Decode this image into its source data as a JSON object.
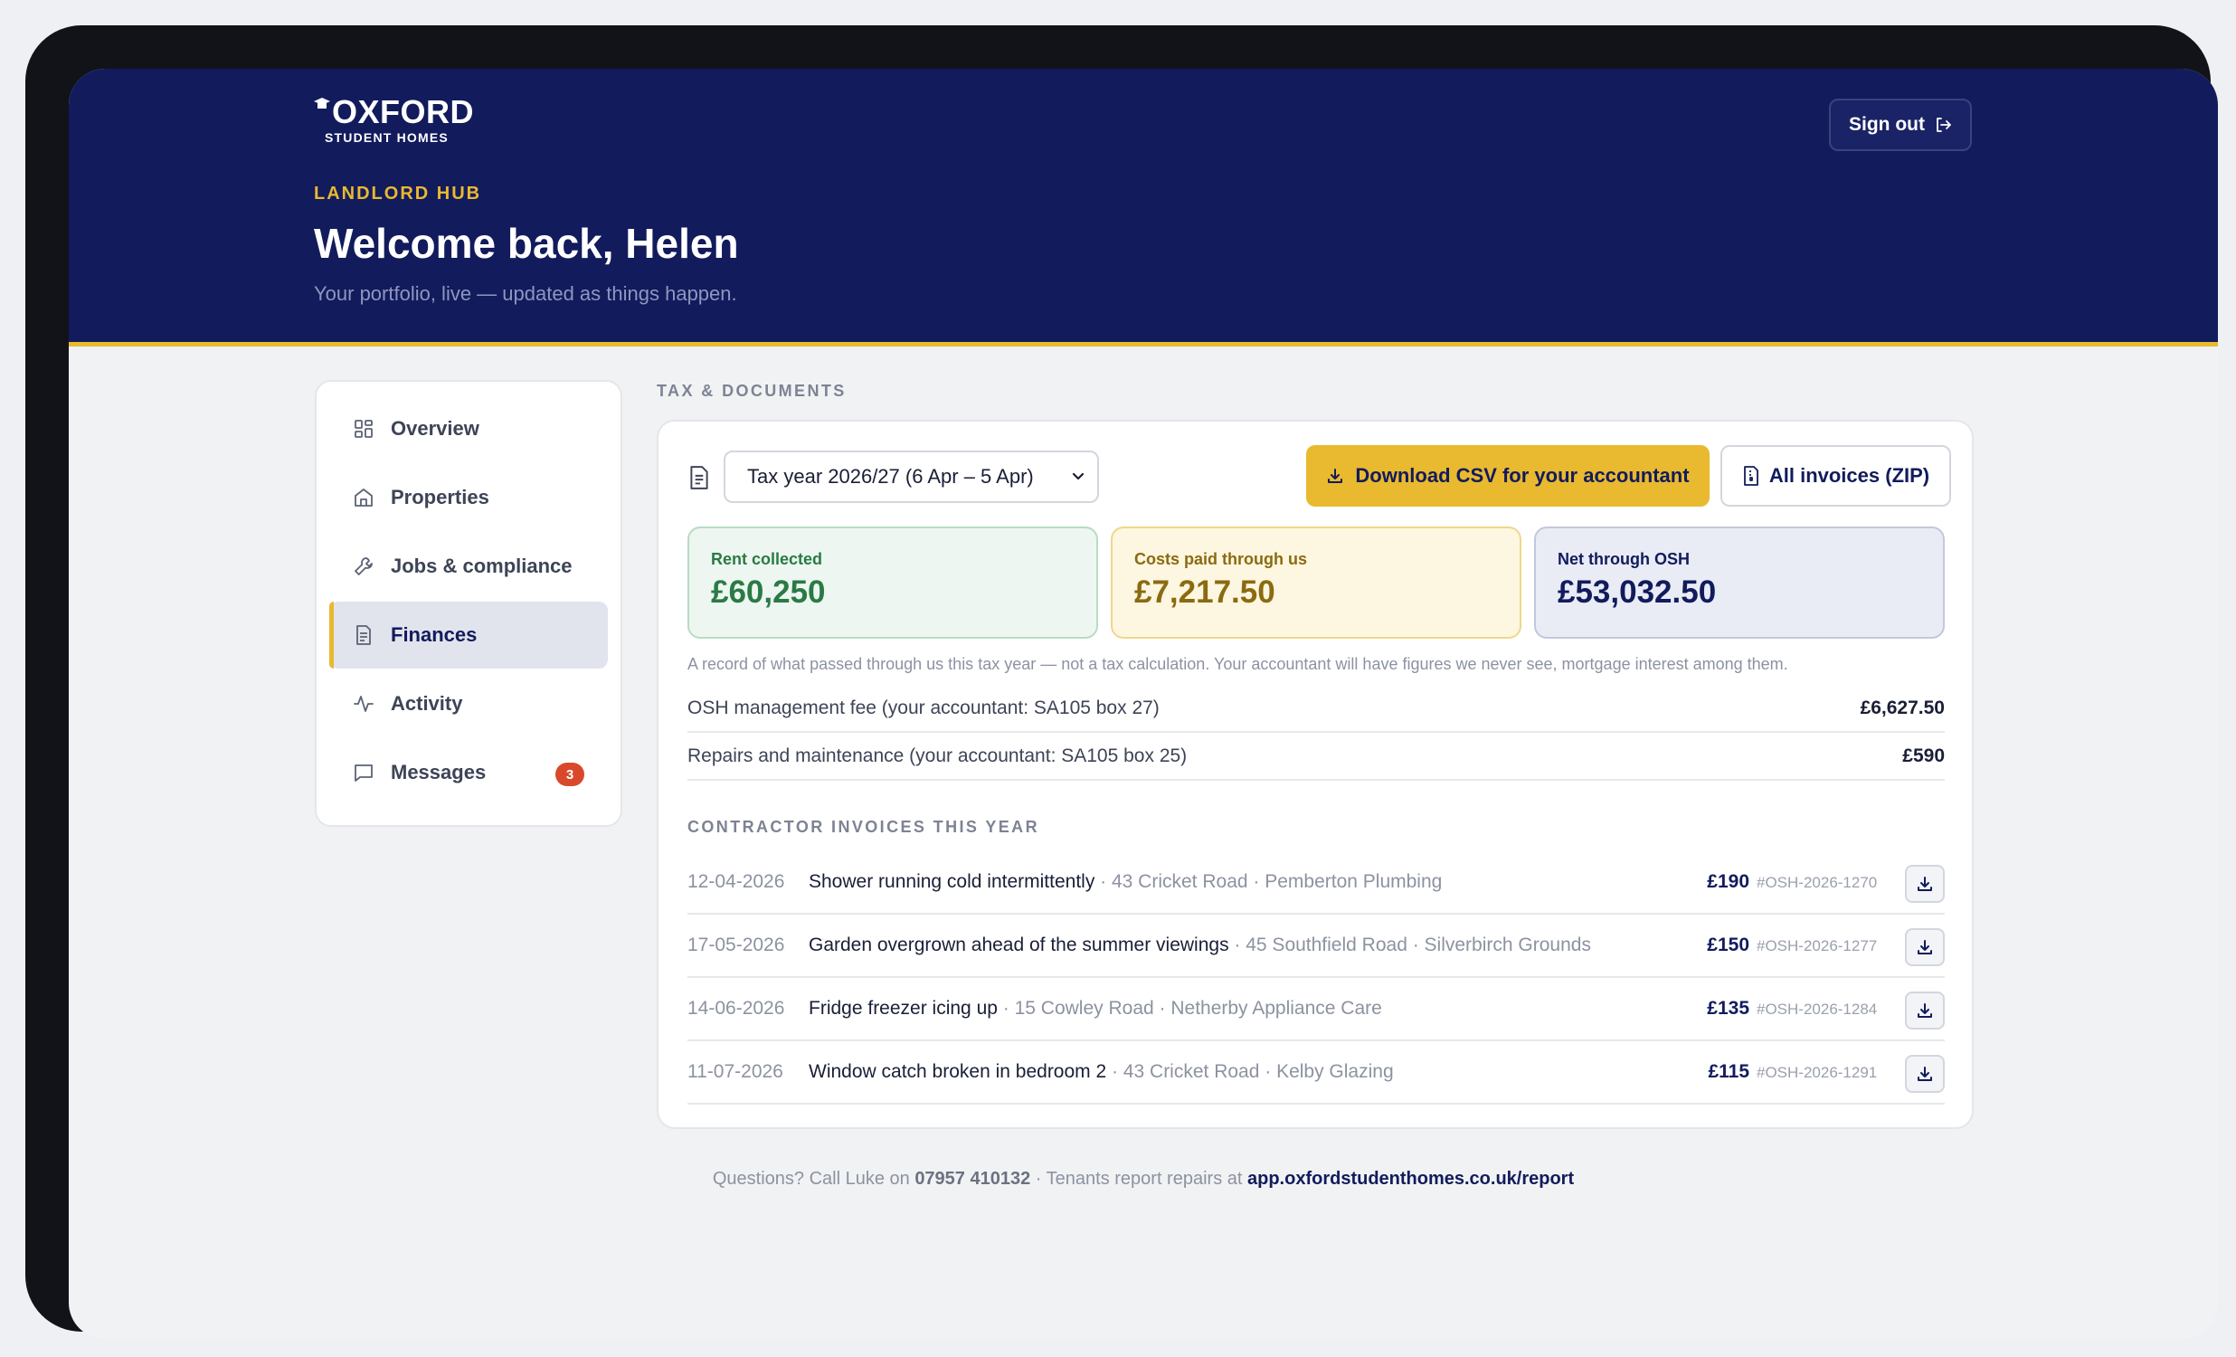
{
  "brand": {
    "name": "OXFORD",
    "sub": "STUDENT HOMES"
  },
  "header": {
    "kicker": "LANDLORD HUB",
    "welcome": "Welcome back, Helen",
    "tagline": "Your portfolio, live — updated as things happen.",
    "sign_out": "Sign out"
  },
  "sidebar": {
    "items": [
      {
        "label": "Overview",
        "icon": "grid-icon"
      },
      {
        "label": "Properties",
        "icon": "home-icon"
      },
      {
        "label": "Jobs & compliance",
        "icon": "wrench-icon"
      },
      {
        "label": "Finances",
        "icon": "document-icon",
        "active": true
      },
      {
        "label": "Activity",
        "icon": "activity-icon"
      },
      {
        "label": "Messages",
        "icon": "message-icon",
        "badge": "3"
      }
    ]
  },
  "section": {
    "title": "TAX & DOCUMENTS"
  },
  "tax": {
    "year_selected": "Tax year 2026/27 (6 Apr – 5 Apr)",
    "download_csv": "Download CSV for your accountant",
    "all_invoices": "All invoices (ZIP)"
  },
  "stats": {
    "rent": {
      "label": "Rent collected",
      "value": "£60,250"
    },
    "costs": {
      "label": "Costs paid through us",
      "value": "£7,217.50"
    },
    "net": {
      "label": "Net through OSH",
      "value": "£53,032.50"
    }
  },
  "note": "A record of what passed through us this tax year — not a tax calculation. Your accountant will have figures we never see, mortgage interest among them.",
  "fees": [
    {
      "label": "OSH management fee (your accountant: SA105 box 27)",
      "amount": "£6,627.50"
    },
    {
      "label": "Repairs and maintenance (your accountant: SA105 box 25)",
      "amount": "£590"
    }
  ],
  "invoices_title": "CONTRACTOR INVOICES THIS YEAR",
  "invoices": [
    {
      "date": "12-04-2026",
      "title": "Shower running cold intermittently",
      "meta": " · 43 Cricket Road · Pemberton Plumbing",
      "amount": "£190",
      "ref": "#OSH-2026-1270"
    },
    {
      "date": "17-05-2026",
      "title": "Garden overgrown ahead of the summer viewings",
      "meta": " · 45 Southfield Road · Silverbirch Grounds",
      "amount": "£150",
      "ref": "#OSH-2026-1277"
    },
    {
      "date": "14-06-2026",
      "title": "Fridge freezer icing up",
      "meta": " · 15 Cowley Road · Netherby Appliance Care",
      "amount": "£135",
      "ref": "#OSH-2026-1284"
    },
    {
      "date": "11-07-2026",
      "title": "Window catch broken in bedroom 2",
      "meta": " · 43 Cricket Road · Kelby Glazing",
      "amount": "£115",
      "ref": "#OSH-2026-1291"
    }
  ],
  "footer": {
    "prefix": "Questions? Call Luke on ",
    "phone": "07957 410132",
    "middle": " · Tenants report repairs at ",
    "link": "app.oxfordstudenthomes.co.uk/report"
  },
  "colors": {
    "navy": "#121b5c",
    "accent": "#e9b92f",
    "green": "#2a7a45",
    "badge": "#d9482b"
  }
}
